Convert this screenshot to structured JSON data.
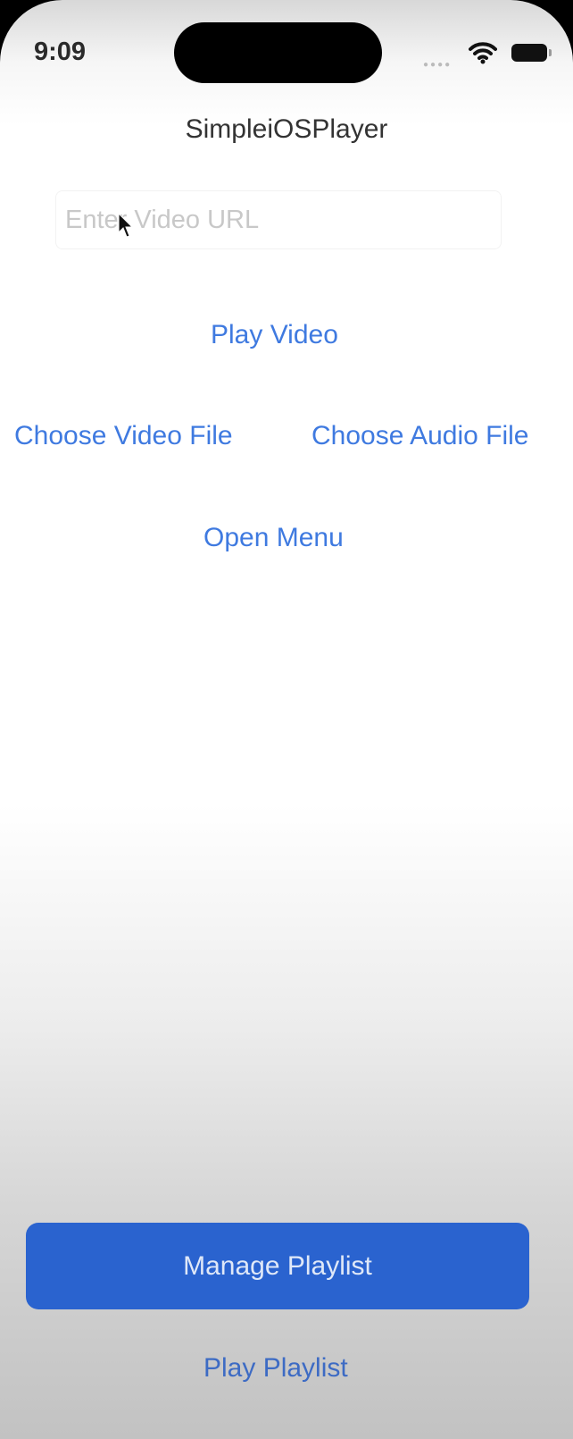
{
  "status_bar": {
    "time": "9:09",
    "signal_icon": "signal-dots-icon",
    "wifi_icon": "wifi-icon",
    "battery_icon": "battery-icon"
  },
  "app": {
    "title": "SimpleiOSPlayer"
  },
  "url_field": {
    "placeholder": "Enter Video URL",
    "value": ""
  },
  "buttons": {
    "play_video": "Play Video",
    "choose_video": "Choose Video File",
    "choose_audio": "Choose Audio File",
    "open_menu": "Open Menu",
    "manage_playlist": "Manage Playlist",
    "play_playlist": "Play Playlist"
  },
  "colors": {
    "accent": "#3f7ae0",
    "primary_button": "#2a63cf"
  }
}
